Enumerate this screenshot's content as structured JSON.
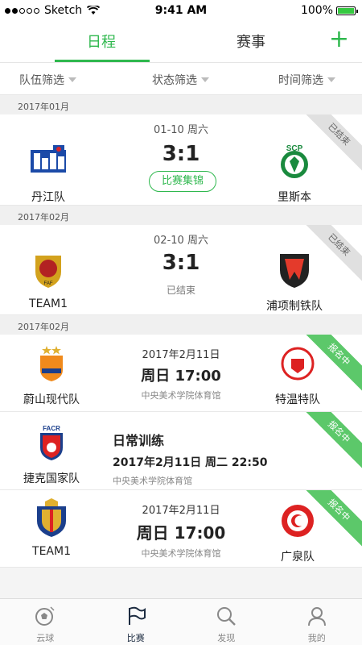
{
  "status_bar": {
    "carrier": "Sketch",
    "time": "9:41 AM",
    "battery": "100%"
  },
  "tabs": [
    {
      "label": "日程"
    },
    {
      "label": "赛事"
    }
  ],
  "filters": [
    {
      "label": "队伍筛选"
    },
    {
      "label": "状态筛选"
    },
    {
      "label": "时间筛选"
    }
  ],
  "sections": [
    {
      "header": "2017年01月"
    },
    {
      "header": "2017年02月"
    },
    {
      "header": "2017年02月"
    }
  ],
  "cards": [
    {
      "date": "01-10 周六",
      "home": "丹江队",
      "away": "里斯本",
      "score": "3:1",
      "button": "比赛集锦",
      "ribbon": "已结束"
    },
    {
      "date": "02-10 周六",
      "home": "TEAM1",
      "away": "浦项制铁队",
      "score": "3:1",
      "status": "已结束",
      "ribbon": "已结束"
    },
    {
      "home": "蔚山现代队",
      "away": "特温特队",
      "date": "2017年2月11日",
      "time": "周日 17:00",
      "venue": "中央美术学院体育馆",
      "ribbon": "报名中"
    },
    {
      "team": "捷克国家队",
      "title": "日常训练",
      "time": "2017年2月11日 周二 22:50",
      "venue": "中央美术学院体育馆",
      "ribbon": "报名中"
    },
    {
      "home": "TEAM1",
      "away": "广泉队",
      "date": "2017年2月11日",
      "time": "周日 17:00",
      "venue": "中央美术学院体育馆",
      "ribbon": "报名中"
    }
  ],
  "bottom_nav": [
    {
      "label": "云球",
      "icon": "soccer-ball-icon"
    },
    {
      "label": "比赛",
      "icon": "flag-icon"
    },
    {
      "label": "发现",
      "icon": "search-icon"
    },
    {
      "label": "我的",
      "icon": "user-icon"
    }
  ],
  "colors": {
    "accent": "#2fb84e",
    "ribbon_green": "#5cc86a",
    "ribbon_gray": "#e0e0e0"
  }
}
